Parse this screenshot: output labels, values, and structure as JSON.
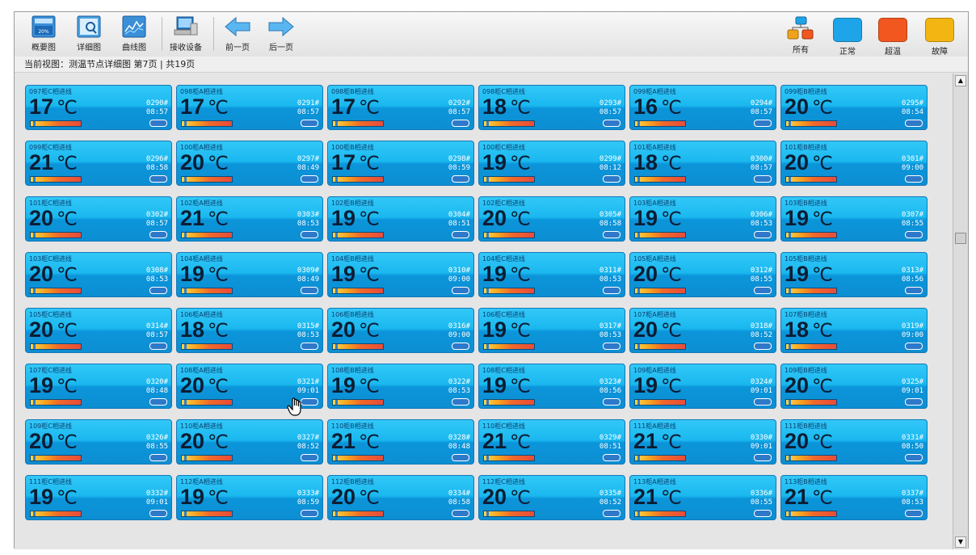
{
  "toolbar": {
    "buttons": [
      {
        "label": "概要图",
        "icon": "summary-view-icon"
      },
      {
        "label": "详细图",
        "icon": "detail-view-icon"
      },
      {
        "label": "曲线图",
        "icon": "curve-chart-icon"
      },
      {
        "label": "接收设备",
        "icon": "receive-device-icon"
      },
      {
        "label": "前一页",
        "icon": "arrow-left-icon"
      },
      {
        "label": "后一页",
        "icon": "arrow-right-icon"
      }
    ],
    "filters": [
      {
        "label": "所有",
        "color": "#f0a21c"
      },
      {
        "label": "正常",
        "color": "#1ea4e9"
      },
      {
        "label": "超温",
        "color": "#f1571e"
      },
      {
        "label": "故障",
        "color": "#f3b512"
      }
    ]
  },
  "breadcrumb": "当前视图：测温节点详细图  第7页 | 共19页",
  "colors": {
    "tile_blue": "#1ab8ef",
    "all_orange": "#f0a21c",
    "normal_blue": "#1ea4e9",
    "overtemp_red": "#f1571e",
    "fault_yellow": "#f3b512"
  },
  "tiles": [
    {
      "name": "097柜C相进线",
      "temp": "17",
      "unit": "℃",
      "id": "0290#",
      "time": "08:57"
    },
    {
      "name": "098柜A相进线",
      "temp": "17",
      "unit": "℃",
      "id": "0291#",
      "time": "08:57"
    },
    {
      "name": "098柜B相进线",
      "temp": "17",
      "unit": "℃",
      "id": "0292#",
      "time": "08:57"
    },
    {
      "name": "098柜C相进线",
      "temp": "18",
      "unit": "℃",
      "id": "0293#",
      "time": "08:57"
    },
    {
      "name": "099柜A相进线",
      "temp": "16",
      "unit": "℃",
      "id": "0294#",
      "time": "08:57"
    },
    {
      "name": "099柜B相进线",
      "temp": "20",
      "unit": "℃",
      "id": "0295#",
      "time": "08:54"
    },
    {
      "name": "099柜C相进线",
      "temp": "21",
      "unit": "℃",
      "id": "0296#",
      "time": "08:58"
    },
    {
      "name": "100柜A相进线",
      "temp": "20",
      "unit": "℃",
      "id": "0297#",
      "time": "08:49"
    },
    {
      "name": "100柜B相进线",
      "temp": "17",
      "unit": "℃",
      "id": "0298#",
      "time": "08:59"
    },
    {
      "name": "100柜C相进线",
      "temp": "19",
      "unit": "℃",
      "id": "0299#",
      "time": "08:12"
    },
    {
      "name": "101柜A相进线",
      "temp": "18",
      "unit": "℃",
      "id": "0300#",
      "time": "08:57"
    },
    {
      "name": "101柜B相进线",
      "temp": "20",
      "unit": "℃",
      "id": "0301#",
      "time": "09:00"
    },
    {
      "name": "101柜C相进线",
      "temp": "20",
      "unit": "℃",
      "id": "0302#",
      "time": "08:57"
    },
    {
      "name": "102柜A相进线",
      "temp": "21",
      "unit": "℃",
      "id": "0303#",
      "time": "08:53"
    },
    {
      "name": "102柜B相进线",
      "temp": "19",
      "unit": "℃",
      "id": "0304#",
      "time": "08:51"
    },
    {
      "name": "102柜C相进线",
      "temp": "20",
      "unit": "℃",
      "id": "0305#",
      "time": "08:58"
    },
    {
      "name": "103柜A相进线",
      "temp": "19",
      "unit": "℃",
      "id": "0306#",
      "time": "08:53"
    },
    {
      "name": "103柜B相进线",
      "temp": "19",
      "unit": "℃",
      "id": "0307#",
      "time": "08:55"
    },
    {
      "name": "103柜C相进线",
      "temp": "20",
      "unit": "℃",
      "id": "0308#",
      "time": "08:53"
    },
    {
      "name": "104柜A相进线",
      "temp": "19",
      "unit": "℃",
      "id": "0309#",
      "time": "08:49"
    },
    {
      "name": "104柜B相进线",
      "temp": "19",
      "unit": "℃",
      "id": "0310#",
      "time": "09:00"
    },
    {
      "name": "104柜C相进线",
      "temp": "19",
      "unit": "℃",
      "id": "0311#",
      "time": "08:53"
    },
    {
      "name": "105柜A相进线",
      "temp": "20",
      "unit": "℃",
      "id": "0312#",
      "time": "08:55"
    },
    {
      "name": "105柜B相进线",
      "temp": "19",
      "unit": "℃",
      "id": "0313#",
      "time": "08:56"
    },
    {
      "name": "105柜C相进线",
      "temp": "20",
      "unit": "℃",
      "id": "0314#",
      "time": "08:57"
    },
    {
      "name": "106柜A相进线",
      "temp": "18",
      "unit": "℃",
      "id": "0315#",
      "time": "08:53"
    },
    {
      "name": "106柜B相进线",
      "temp": "20",
      "unit": "℃",
      "id": "0316#",
      "time": "09:00"
    },
    {
      "name": "106柜C相进线",
      "temp": "19",
      "unit": "℃",
      "id": "0317#",
      "time": "08:53"
    },
    {
      "name": "107柜A相进线",
      "temp": "20",
      "unit": "℃",
      "id": "0318#",
      "time": "08:52"
    },
    {
      "name": "107柜B相进线",
      "temp": "18",
      "unit": "℃",
      "id": "0319#",
      "time": "09:00"
    },
    {
      "name": "107柜C相进线",
      "temp": "19",
      "unit": "℃",
      "id": "0320#",
      "time": "08:48"
    },
    {
      "name": "108柜A相进线",
      "temp": "20",
      "unit": "℃",
      "id": "0321#",
      "time": "09:01"
    },
    {
      "name": "108柜B相进线",
      "temp": "19",
      "unit": "℃",
      "id": "0322#",
      "time": "08:53"
    },
    {
      "name": "108柜C相进线",
      "temp": "19",
      "unit": "℃",
      "id": "0323#",
      "time": "08:56"
    },
    {
      "name": "109柜A相进线",
      "temp": "19",
      "unit": "℃",
      "id": "0324#",
      "time": "09:01"
    },
    {
      "name": "109柜B相进线",
      "temp": "20",
      "unit": "℃",
      "id": "0325#",
      "time": "09:01"
    },
    {
      "name": "109柜C相进线",
      "temp": "20",
      "unit": "℃",
      "id": "0326#",
      "time": "08:55"
    },
    {
      "name": "110柜A相进线",
      "temp": "20",
      "unit": "℃",
      "id": "0327#",
      "time": "08:52"
    },
    {
      "name": "110柜B相进线",
      "temp": "21",
      "unit": "℃",
      "id": "0328#",
      "time": "08:48"
    },
    {
      "name": "110柜C相进线",
      "temp": "21",
      "unit": "℃",
      "id": "0329#",
      "time": "08:51"
    },
    {
      "name": "111柜A相进线",
      "temp": "21",
      "unit": "℃",
      "id": "0330#",
      "time": "09:01"
    },
    {
      "name": "111柜B相进线",
      "temp": "20",
      "unit": "℃",
      "id": "0331#",
      "time": "08:50"
    },
    {
      "name": "111柜C相进线",
      "temp": "19",
      "unit": "℃",
      "id": "0332#",
      "time": "09:01"
    },
    {
      "name": "112柜A相进线",
      "temp": "19",
      "unit": "℃",
      "id": "0333#",
      "time": "08:59"
    },
    {
      "name": "112柜B相进线",
      "temp": "20",
      "unit": "℃",
      "id": "0334#",
      "time": "08:58"
    },
    {
      "name": "112柜C相进线",
      "temp": "20",
      "unit": "℃",
      "id": "0335#",
      "time": "08:52"
    },
    {
      "name": "113柜A相进线",
      "temp": "21",
      "unit": "℃",
      "id": "0336#",
      "time": "08:55"
    },
    {
      "name": "113柜B相进线",
      "temp": "21",
      "unit": "℃",
      "id": "0337#",
      "time": "08:53"
    }
  ],
  "scrollbar": {
    "up_glyph": "▲",
    "down_glyph": "▼"
  }
}
